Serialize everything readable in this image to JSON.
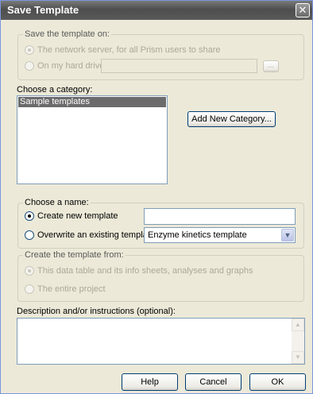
{
  "dialog": {
    "title": "Save Template",
    "close_glyph": "✕"
  },
  "save_on": {
    "legend": "Save the template on:",
    "network_label": "The network server, for all Prism users to share",
    "harddrive_label": "On my hard drive",
    "path_value": "",
    "browse_label": "..."
  },
  "category": {
    "label": "Choose a category:",
    "items": [
      "Sample templates"
    ],
    "add_button": "Add New Category..."
  },
  "name": {
    "legend": "Choose a name:",
    "create_label": "Create new template",
    "create_value": "",
    "overwrite_label": "Overwrite an existing template",
    "overwrite_selected": "Enzyme kinetics template"
  },
  "from": {
    "legend": "Create the template from:",
    "table_label": "This data table and its info sheets, analyses and graphs",
    "project_label": "The entire project"
  },
  "description": {
    "label": "Description and/or instructions (optional):",
    "value": ""
  },
  "buttons": {
    "help": "Help",
    "cancel": "Cancel",
    "ok": "OK"
  },
  "icons": {
    "close": "close-icon",
    "dropdown": "chevron-down-icon",
    "scroll_up": "scroll-up-icon",
    "scroll_down": "scroll-down-icon"
  }
}
